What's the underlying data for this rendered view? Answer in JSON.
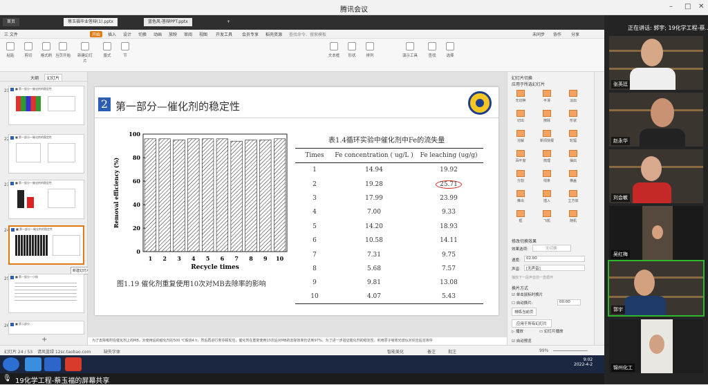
{
  "window": {
    "title": "腾讯会议",
    "controls": [
      "–",
      "□",
      "✕"
    ]
  },
  "tabs": {
    "items": [
      "首页",
      "蔡玉福毕业答辩(1).pptx",
      "蓝色风-答辩PPT.pptx",
      "+"
    ]
  },
  "menu": {
    "items": [
      "三 文件",
      "开始",
      "插入",
      "设计",
      "切换",
      "动画",
      "放映",
      "审阅",
      "视图",
      "开发工具",
      "会员专享",
      "稻壳资源"
    ],
    "search": "查找命令、搜索模板",
    "right": [
      "未同步",
      "协作",
      "分享"
    ]
  },
  "ribbon": {
    "buttons": [
      "粘贴",
      "剪切",
      "复制",
      "格式刷",
      "当页开始",
      "新建幻灯片",
      "版式",
      "节",
      "重置",
      "文本框",
      "形状",
      "排列",
      "轮廓",
      "演示工具",
      "查找",
      "替换",
      "选择"
    ]
  },
  "left_panel": {
    "tabs": [
      "大纲",
      "幻灯片"
    ],
    "slides": [
      {
        "num": "21",
        "title": "■ 第一部分—催化剂的稳定性"
      },
      {
        "num": "22",
        "title": "■ 第一部分—催化剂的稳定性"
      },
      {
        "num": "23",
        "title": "■ 第一部分—催化剂的稳定性"
      },
      {
        "num": "24",
        "title": "■ 第一部分—催化剂的稳定性"
      },
      {
        "num": "25",
        "title": "■ 第一部分—小结"
      },
      {
        "num": "26",
        "title": "■ 第二部分..."
      }
    ],
    "tooltip": "新建幻灯片"
  },
  "slide": {
    "number": "2",
    "title": "第一部分—催化剂的稳定性",
    "caption": "图1.19 催化剂重复使用10次对MB去除率的影响"
  },
  "chart_data": {
    "type": "bar",
    "categories": [
      "1",
      "2",
      "3",
      "4",
      "5",
      "6",
      "7",
      "8",
      "9",
      "10"
    ],
    "values": [
      96,
      96,
      95,
      96,
      96,
      96,
      94,
      95,
      95,
      96
    ],
    "xlabel": "Recycle times",
    "ylabel": "Removal efficiency (%)",
    "ylim": [
      0,
      100
    ],
    "yticks": [
      "0",
      "20",
      "40",
      "60",
      "80",
      "100"
    ],
    "grid": false
  },
  "table": {
    "title": "表1.4循环实验中催化剂中Fe的流失量",
    "headers": [
      "Times",
      "Fe concentration ( ug/L )",
      "Fe leaching (ug/g)"
    ],
    "rows": [
      [
        "1",
        "14.94",
        "19.92"
      ],
      [
        "2",
        "19.28",
        "25.71"
      ],
      [
        "3",
        "17.99",
        "23.99"
      ],
      [
        "4",
        "7.00",
        "9.33"
      ],
      [
        "5",
        "14.20",
        "18.93"
      ],
      [
        "6",
        "10.58",
        "14.11"
      ],
      [
        "7",
        "7.31",
        "9.75"
      ],
      [
        "8",
        "5.68",
        "7.57"
      ],
      [
        "9",
        "9.81",
        "13.08"
      ],
      [
        "10",
        "4.07",
        "5.43"
      ]
    ]
  },
  "right_panel": {
    "title": "幻灯片切换",
    "apply": "应用于所选幻灯片",
    "transitions": [
      "无切换",
      "平滑",
      "淡出",
      "切出",
      "擦除",
      "形状",
      "溶解",
      "新闻快报",
      "轮辐",
      "百叶窗",
      "梳理",
      "抽出",
      "分割",
      "线条",
      "横盖",
      "推出",
      "插入",
      "立方体",
      "框",
      "飞机",
      "随机"
    ],
    "modify": "修改切换效果",
    "effect_label": "效果选项:",
    "effect_value": "无切换",
    "speed_label": "速度:",
    "speed_value": "02.00",
    "sound_label": "声音:",
    "sound_value": "[无声音]",
    "loop": "播放下一段声音前一直循环",
    "advance": "换片方式",
    "click": "单击鼠标时换片",
    "auto": "自动换片:",
    "auto_value": "00:00",
    "sort": "排练当前页",
    "apply_all": "应用于所有幻灯片",
    "play": "播放",
    "slideshow": "幻灯片播放",
    "autopreview": "自动预览"
  },
  "notes": "为了去除吸附在催化剂上的MB，对使用后的催化剂在500 ℃煅烧4 h，然后再进行类芬顿反应，催化剂在重复使用10次后对MB的去除效率仍达到97%。为了进一步验证催化剂的稳定性，利用原子吸收光谱仪对反应后溶液中",
  "status": {
    "slide": "幻灯片 24 / 53",
    "theme": "请风蓝绿 12sc.taobao.com",
    "rename": "缺失字体",
    "smart": "智能美化",
    "notes": "备注",
    "comment": "批注",
    "zoom": "99%"
  },
  "taskbar": {
    "time": "9:02",
    "date": "2022-4-2"
  },
  "bottom": {
    "share": "19化学工程-蔡玉福的屏幕共享"
  },
  "video": {
    "speaking": "正在讲话: 郭宇; 19化学工程-蔡...",
    "participants": [
      "张英廷",
      "赵永华",
      "刘会敏",
      "吴红梅",
      "郭宇",
      "锦州化工"
    ]
  }
}
